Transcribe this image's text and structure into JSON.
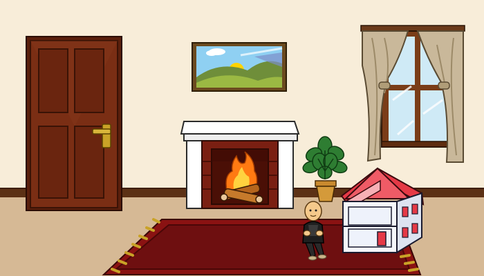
{
  "scene": {
    "kind": "room",
    "items": [
      {
        "name": "door",
        "color": "#7a2e14",
        "handle_color": "#c9a227"
      },
      {
        "name": "landscape-painting",
        "frame_color": "#6b4a1f"
      },
      {
        "name": "fireplace",
        "fire": "lit"
      },
      {
        "name": "potted-plant"
      },
      {
        "name": "window-with-curtains",
        "curtain_color": "#c9b89a"
      },
      {
        "name": "rug",
        "color": "#6e0f10"
      },
      {
        "name": "child-character",
        "pose": "sitting"
      },
      {
        "name": "dollhouse",
        "roof_color": "#e53946"
      }
    ]
  },
  "palette": {
    "wall": "#f8edd9",
    "floor": "#d6b995",
    "baseboard": "#5c3115"
  }
}
